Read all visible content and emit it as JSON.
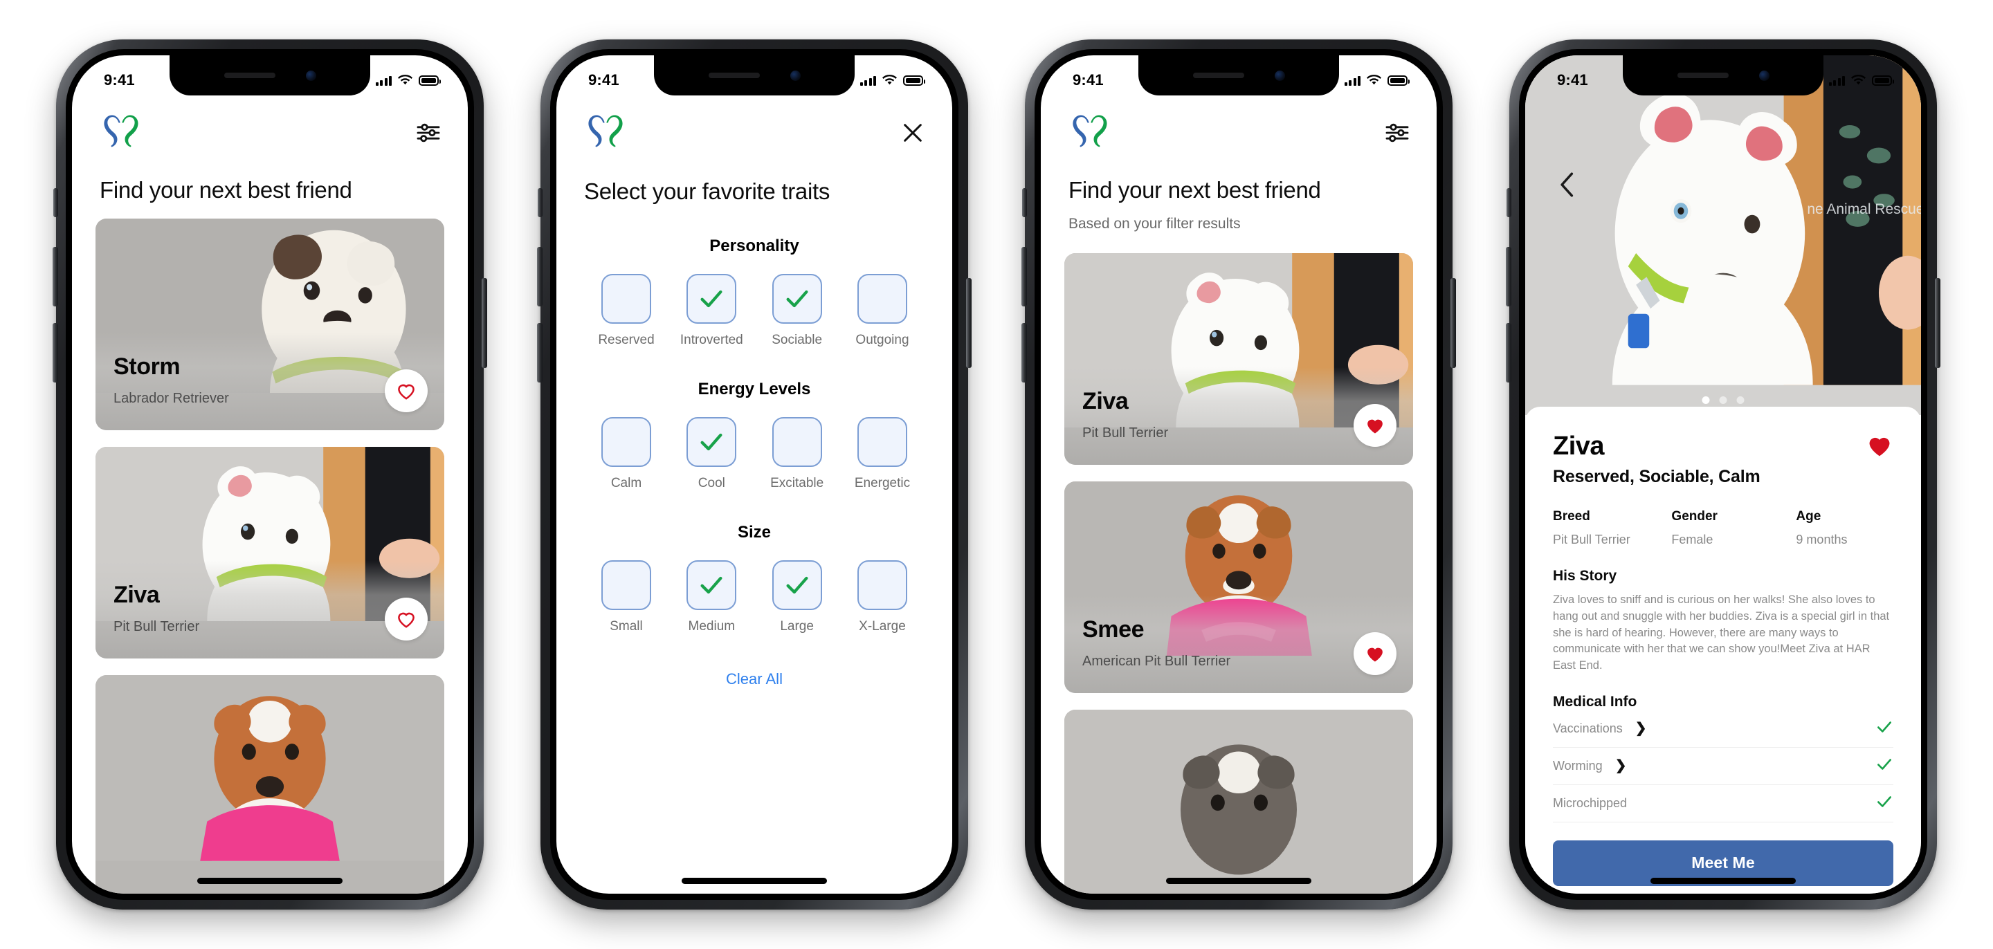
{
  "status_bar": {
    "time": "9:41",
    "signal_icon": "cellular-bars-icon",
    "wifi_icon": "wifi-icon",
    "battery_icon": "battery-icon"
  },
  "brand": {
    "logo_name": "paw-heart-logo",
    "logo_blue": "#3565ae",
    "logo_green": "#12a04a"
  },
  "screens": [
    {
      "id": "browse",
      "app_bar": {
        "logo": "paw-heart-logo",
        "action_icon": "filter-sliders-icon"
      },
      "title": "Find your next best friend",
      "cards": [
        {
          "name": "Storm",
          "breed": "Labrador Retriever",
          "favorite": false,
          "fav_icon": "heart-outline-icon"
        },
        {
          "name": "Ziva",
          "breed": "Pit Bull Terrier",
          "favorite": false,
          "fav_icon": "heart-outline-icon"
        },
        {
          "name": "",
          "breed": "",
          "favorite": false,
          "fav_icon": "heart-outline-icon"
        }
      ]
    },
    {
      "id": "filters",
      "app_bar": {
        "logo": "paw-heart-logo",
        "action_icon": "close-x-icon"
      },
      "title": "Select your favorite traits",
      "groups": [
        {
          "title": "Personality",
          "options": [
            {
              "label": "Reserved",
              "checked": false
            },
            {
              "label": "Introverted",
              "checked": true
            },
            {
              "label": "Sociable",
              "checked": true
            },
            {
              "label": "Outgoing",
              "checked": false
            }
          ]
        },
        {
          "title": "Energy Levels",
          "options": [
            {
              "label": "Calm",
              "checked": false
            },
            {
              "label": "Cool",
              "checked": true
            },
            {
              "label": "Excitable",
              "checked": false
            },
            {
              "label": "Energetic",
              "checked": false
            }
          ]
        },
        {
          "title": "Size",
          "options": [
            {
              "label": "Small",
              "checked": false
            },
            {
              "label": "Medium",
              "checked": true
            },
            {
              "label": "Large",
              "checked": true
            },
            {
              "label": "X-Large",
              "checked": false
            }
          ]
        }
      ],
      "clear_all": "Clear All",
      "link_color": "#2f80ed",
      "check_color": "#18a24a"
    },
    {
      "id": "results",
      "app_bar": {
        "logo": "paw-heart-logo",
        "action_icon": "filter-sliders-icon"
      },
      "title": "Find your next best friend",
      "subtitle": "Based on your filter results",
      "cards": [
        {
          "name": "Ziva",
          "breed": "Pit Bull Terrier",
          "favorite": true,
          "fav_icon": "heart-filled-icon"
        },
        {
          "name": "Smee",
          "breed": "American Pit Bull Terrier",
          "favorite": true,
          "fav_icon": "heart-filled-icon"
        },
        {
          "name": "",
          "breed": "",
          "favorite": false,
          "fav_icon": "heart-outline-icon"
        }
      ]
    },
    {
      "id": "detail",
      "back_icon": "chevron-left-icon",
      "carousel": {
        "count": 3,
        "active": 0
      },
      "name": "Ziva",
      "favorite_icon": "heart-filled-icon",
      "favorite_color": "#d61021",
      "traits": "Reserved, Sociable, Calm",
      "meta": [
        {
          "key": "Breed",
          "value": "Pit Bull Terrier"
        },
        {
          "key": "Gender",
          "value": "Female"
        },
        {
          "key": "Age",
          "value": "9 months"
        }
      ],
      "story_title": "His Story",
      "story": "Ziva loves to sniff and is curious on her walks! She also loves to hang out and snuggle with her buddies. Ziva is a special girl in that she is hard of hearing. However, there are many ways to communicate with her that we can show you!Meet Ziva at HAR East End.",
      "medical_title": "Medical Info",
      "medical": [
        {
          "label": "Vaccinations",
          "chevron": true,
          "status_icon": "check-icon"
        },
        {
          "label": "Worming",
          "chevron": true,
          "status_icon": "check-icon"
        },
        {
          "label": "Microchipped",
          "chevron": false,
          "status_icon": "check-icon"
        }
      ],
      "cta": "Meet Me",
      "cta_color": "#4169ab"
    }
  ]
}
